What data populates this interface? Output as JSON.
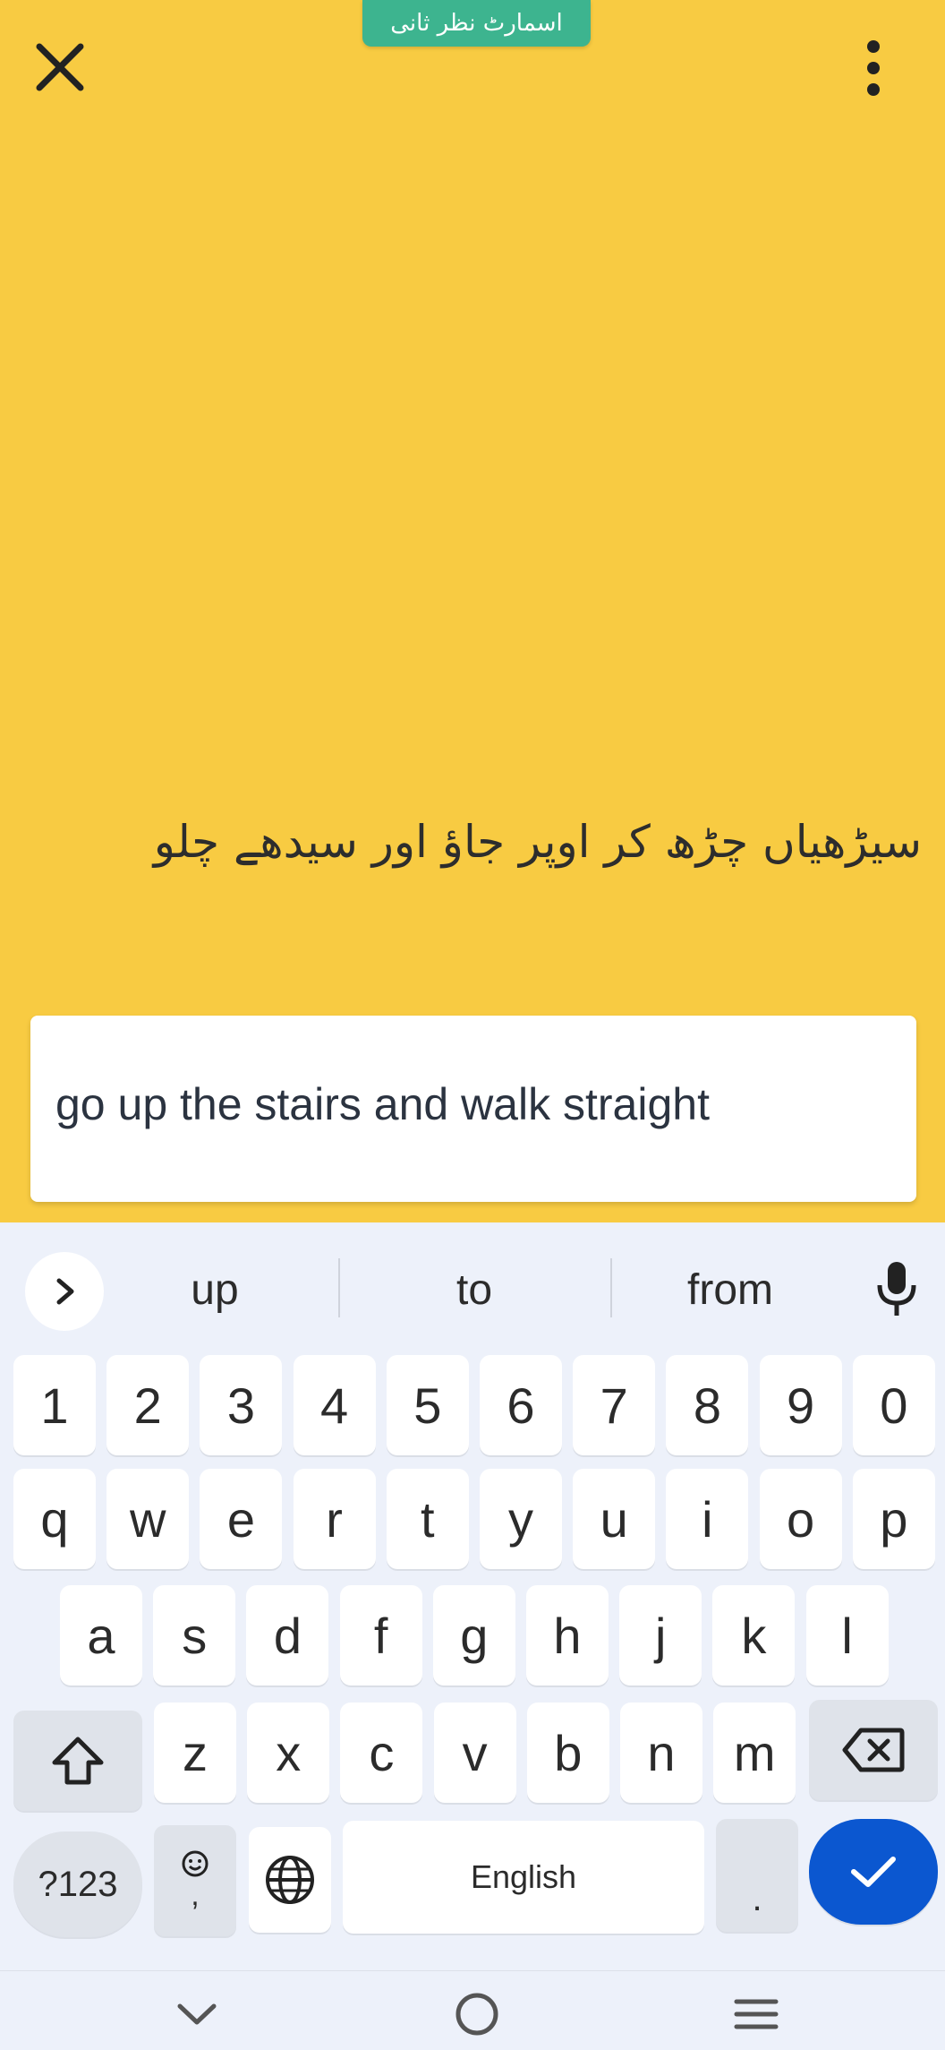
{
  "header": {
    "badge_label": "اسمارٹ نظر ثانی",
    "close_icon": "close-icon",
    "more_icon": "more-vertical-icon"
  },
  "source": {
    "text": "سیڑھیاں چڑھ کر اوپر جاؤ اور سیدھے چلو"
  },
  "translation": {
    "text": "go up the stairs and walk straight"
  },
  "suggestions": {
    "expand_icon": "chevron-right-icon",
    "items": [
      "up",
      "to",
      "from"
    ],
    "mic_icon": "mic-icon"
  },
  "keyboard": {
    "row_numbers": [
      "1",
      "2",
      "3",
      "4",
      "5",
      "6",
      "7",
      "8",
      "9",
      "0"
    ],
    "row_q": [
      "q",
      "w",
      "e",
      "r",
      "t",
      "y",
      "u",
      "i",
      "o",
      "p"
    ],
    "row_a": [
      "a",
      "s",
      "d",
      "f",
      "g",
      "h",
      "j",
      "k",
      "l"
    ],
    "row_z": [
      "z",
      "x",
      "c",
      "v",
      "b",
      "n",
      "m"
    ],
    "symbols_label": "?123",
    "comma_label": ",",
    "space_label": "English",
    "period_label": ".",
    "shift_icon": "shift-icon",
    "backspace_icon": "backspace-icon",
    "emoji_icon": "emoji-icon",
    "globe_icon": "globe-icon",
    "enter_icon": "checkmark-icon"
  },
  "navbar": {
    "back_icon": "chevron-down-icon",
    "home_icon": "home-circle-icon",
    "recents_icon": "menu-lines-icon"
  },
  "colors": {
    "background": "#f8cb42",
    "badge": "#3db48f",
    "enter_key": "#0b57d0",
    "keyboard_bg": "#edf1fa"
  }
}
